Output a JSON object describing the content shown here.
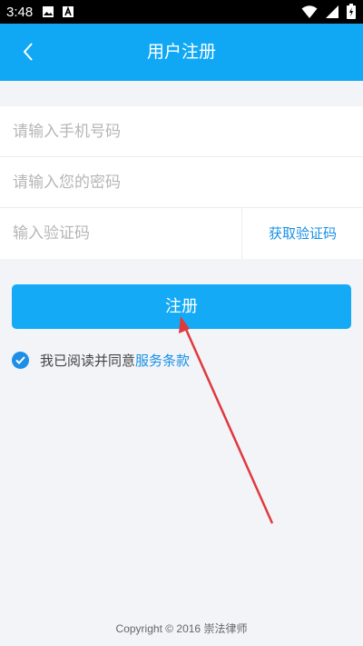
{
  "status_bar": {
    "time": "3:48"
  },
  "header": {
    "title": "用户注册"
  },
  "form": {
    "phone_placeholder": "请输入手机号码",
    "password_placeholder": "请输入您的密码",
    "code_placeholder": "输入验证码",
    "get_code_label": "获取验证码"
  },
  "register_label": "注册",
  "agreement": {
    "text": "我已阅读并同意",
    "link": "服务条款",
    "checked": true
  },
  "footer": {
    "copyright": "Copyright © 2016 崇法律师"
  },
  "colors": {
    "primary": "#10a8f4",
    "link": "#1890e6",
    "background": "#f2f4f8"
  }
}
